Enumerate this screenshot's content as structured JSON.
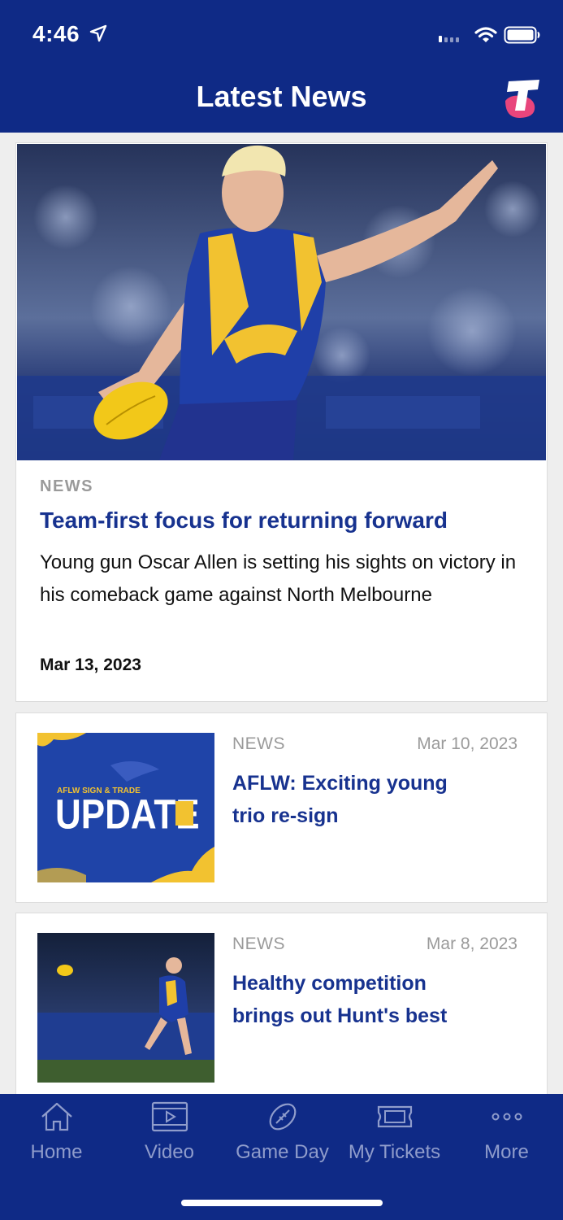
{
  "status_bar": {
    "time": "4:46"
  },
  "header": {
    "title": "Latest News"
  },
  "hero": {
    "kicker": "NEWS",
    "title": "Team-first focus for returning forward",
    "summary": "Young gun Oscar Allen is setting his sights on victory in his comeback game against North Melbourne",
    "date": "Mar 13, 2023"
  },
  "articles": [
    {
      "kicker": "NEWS",
      "date": "Mar 10, 2023",
      "title": "AFLW: Exciting young trio re-sign",
      "thumb_text_1": "AFLW SIGN & TRADE",
      "thumb_text_2": "UPDATE"
    },
    {
      "kicker": "NEWS",
      "date": "Mar 8, 2023",
      "title": "Healthy competition brings out Hunt's best"
    }
  ],
  "tabs": [
    {
      "label": "Home",
      "icon": "home-icon"
    },
    {
      "label": "Video",
      "icon": "video-icon"
    },
    {
      "label": "Game Day",
      "icon": "football-icon"
    },
    {
      "label": "My Tickets",
      "icon": "ticket-icon"
    },
    {
      "label": "More",
      "icon": "more-icon"
    }
  ],
  "colors": {
    "brand_navy": "#0f2a86",
    "title_blue": "#17328f",
    "eagles_yellow": "#f2c230",
    "telstra_pink": "#e8457c"
  }
}
